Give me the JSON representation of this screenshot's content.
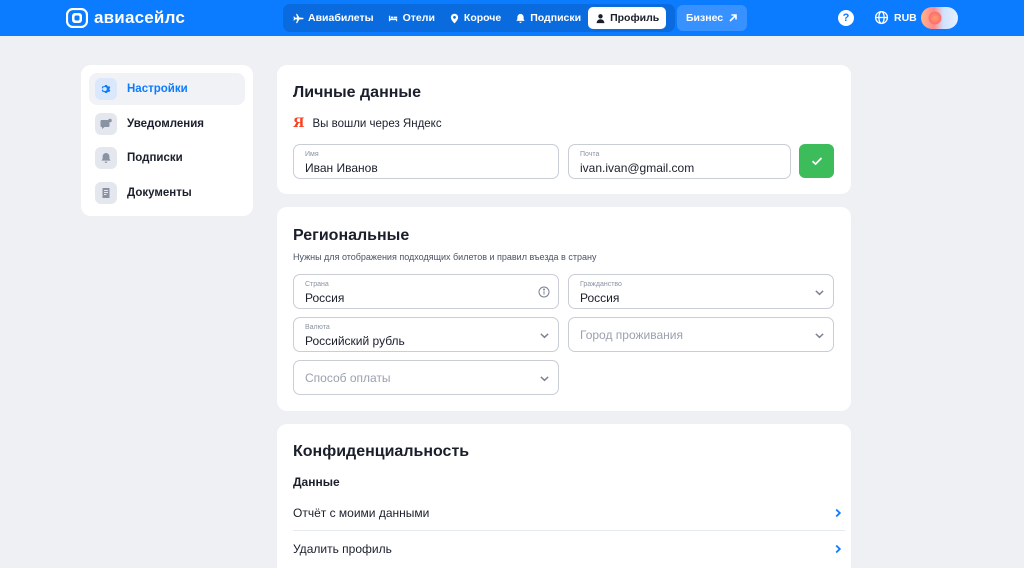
{
  "header": {
    "logo_text": "авиасейлс",
    "nav": [
      {
        "label": "Авиабилеты",
        "icon": "plane-icon"
      },
      {
        "label": "Отели",
        "icon": "bed-icon"
      },
      {
        "label": "Короче",
        "icon": "pin-icon"
      },
      {
        "label": "Подписки",
        "icon": "bell-icon"
      },
      {
        "label": "Профиль",
        "icon": "person-icon",
        "active": true
      }
    ],
    "business_label": "Бизнес",
    "help_label": "?",
    "currency": "RUB"
  },
  "sidebar": {
    "items": [
      {
        "label": "Настройки",
        "icon": "gear-icon",
        "active": true
      },
      {
        "label": "Уведомления",
        "icon": "message-icon"
      },
      {
        "label": "Подписки",
        "icon": "bell-icon"
      },
      {
        "label": "Документы",
        "icon": "document-icon"
      }
    ]
  },
  "personal": {
    "title": "Личные данные",
    "yandex_mark": "Я",
    "login_text": "Вы вошли через Яндекс",
    "name_label": "Имя",
    "name_value": "Иван Иванов",
    "email_label": "Почта",
    "email_value": "ivan.ivan@gmail.com"
  },
  "regional": {
    "title": "Региональные",
    "subtitle": "Нужны для отображения подходящих билетов и правил въезда в страну",
    "country_label": "Страна",
    "country_value": "Россия",
    "citizenship_label": "Гражданство",
    "citizenship_value": "Россия",
    "currency_label": "Валюта",
    "currency_value": "Российский рубль",
    "city_placeholder": "Город проживания",
    "payment_placeholder": "Способ оплаты"
  },
  "privacy": {
    "title": "Конфиденциальность",
    "section": "Данные",
    "rows": [
      "Отчёт с моими данными",
      "Удалить профиль"
    ]
  },
  "colors": {
    "brand": "#0b7bff",
    "success": "#3cbc5a",
    "yandex": "#fc3f1d"
  }
}
